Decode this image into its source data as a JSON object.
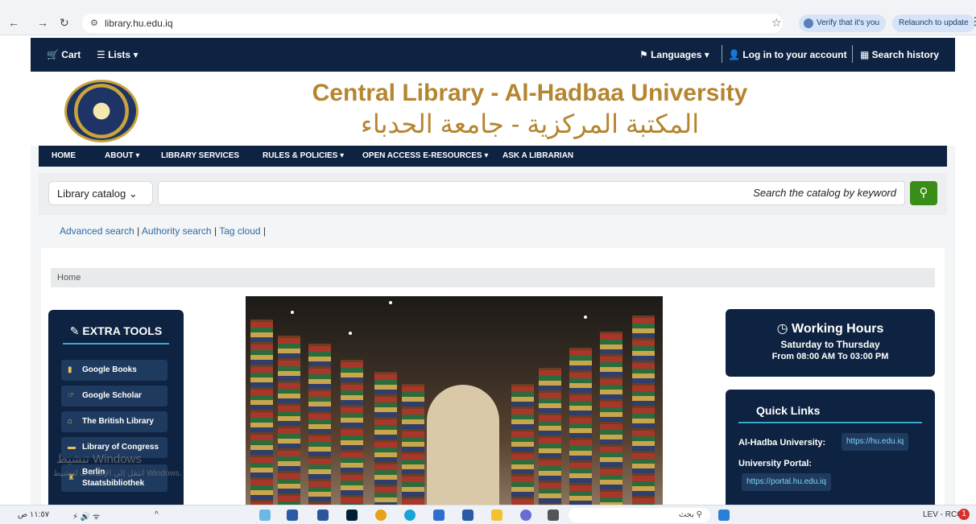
{
  "browser": {
    "url": "library.hu.edu.iq",
    "verify_label": "Verify that it's you",
    "relaunch_label": "Relaunch to update"
  },
  "topnav": {
    "cart": "Cart",
    "lists": "Lists",
    "languages": "Languages",
    "login": "Log in to your account",
    "history": "Search history"
  },
  "header": {
    "title_en": "Central Library - Al-Hadbaa University",
    "title_ar": "المكتبة المركزية - جامعة الحدباء"
  },
  "mainnav": {
    "items": [
      "HOME",
      "ABOUT",
      "LIBRARY SERVICES",
      "RULES & POLICIES",
      "OPEN ACCESS E-RESOURCES",
      "ASK A LIBRARIAN"
    ]
  },
  "search": {
    "catalog_selected": "Library catalog",
    "placeholder": "Search the catalog by keyword"
  },
  "links": {
    "advanced": "Advanced search",
    "authority": "Authority search",
    "tagcloud": "Tag cloud"
  },
  "breadcrumb": "Home",
  "tools": {
    "title": "EXTRA TOOLS",
    "items": [
      "Google Books",
      "Google Scholar",
      "The British Library",
      "Library of Congress",
      "Berlin Staatsbibliothek"
    ]
  },
  "hours": {
    "title": "Working Hours",
    "days": "Saturday to Thursday",
    "time": "From 08:00 AM To 03:00 PM"
  },
  "quick": {
    "title": "Quick Links",
    "uni_label": "Al-Hadba University:",
    "uni_link": "https://hu.edu.iq",
    "portal_label": "University Portal:",
    "portal_link": "https://portal.hu.edu.iq"
  },
  "overlay": {
    "activate": "تنشيط Windows",
    "activate_sub": "انتقل إلى الإعدادات لتنشيط Windows."
  },
  "taskbar": {
    "search": "بحث",
    "device": "LEV - RCC",
    "time": "١١:٥٧ ص",
    "badge": "1"
  },
  "colors": {
    "navy": "#0e2341",
    "gold": "#b5852f",
    "green": "#3b8d1a",
    "link": "#2a6aa8"
  }
}
